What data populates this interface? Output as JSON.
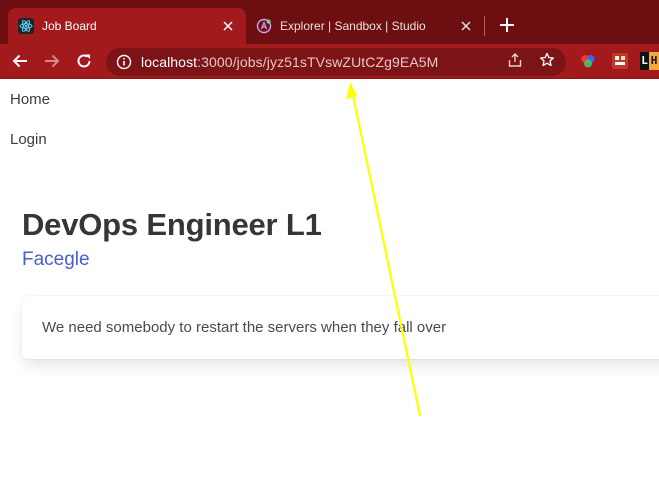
{
  "browser": {
    "tabs": [
      {
        "title": "Job Board",
        "active": true,
        "favicon": "react-icon"
      },
      {
        "title": "Explorer | Sandbox | Studio",
        "active": false,
        "favicon": "apollo-icon"
      }
    ],
    "address_bar": {
      "host": "localhost",
      "path": ":3000/jobs/jyz51sTVswZUtCZg9EA5M"
    },
    "extension_label": "L H"
  },
  "page": {
    "nav": {
      "home": "Home",
      "login": "Login"
    },
    "job": {
      "title": "DevOps Engineer L1",
      "company": "Facegle",
      "description": "We need somebody to restart the servers when they fall over"
    }
  },
  "colors": {
    "tabstrip_bg": "#6d0f10",
    "toolbar_bg": "#a31a1d",
    "link_color": "#485fc7",
    "annotation_arrow": "#ffff00"
  }
}
